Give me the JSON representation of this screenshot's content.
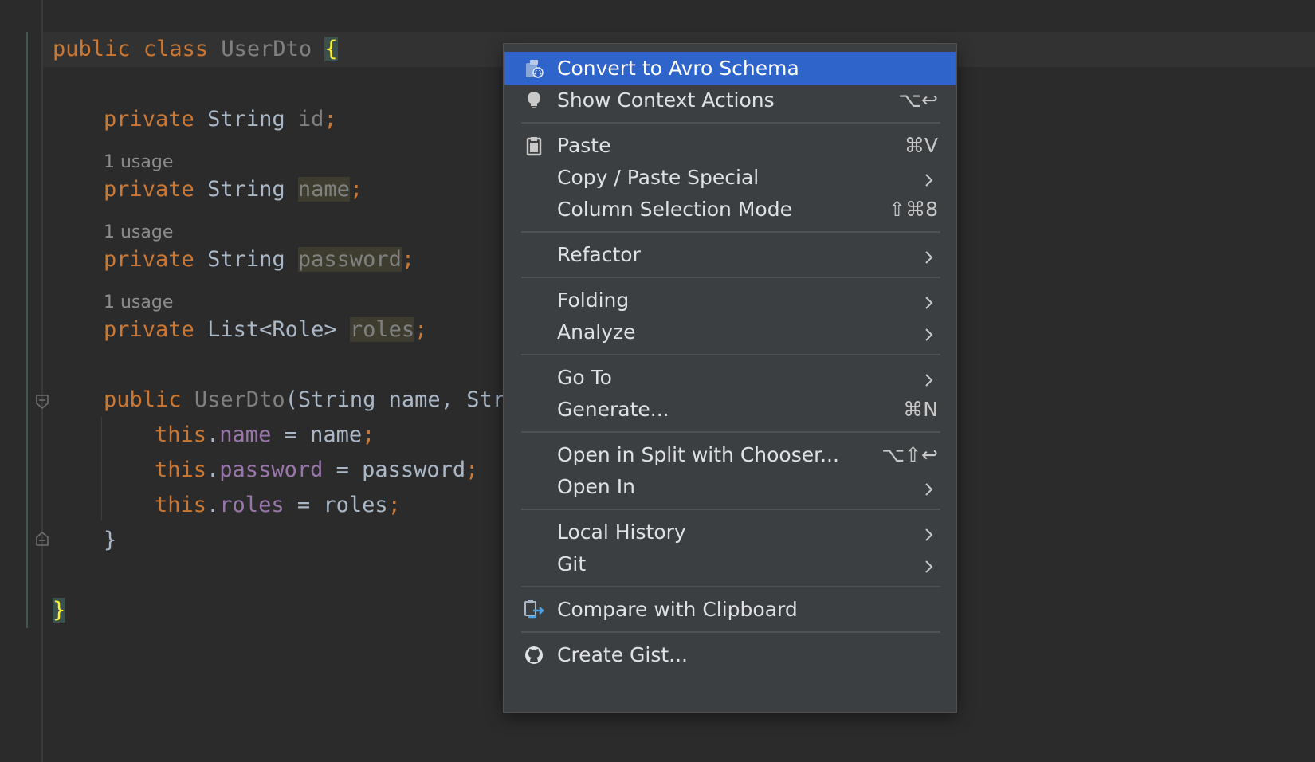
{
  "editor": {
    "lines": {
      "class_decl": {
        "kw1": "public",
        "kw2": "class",
        "name": "UserDto",
        "brace": "{"
      },
      "field_id": {
        "kw": "private",
        "type": "String",
        "name": "id",
        "semi": ";"
      },
      "usage1": "1 usage",
      "field_name": {
        "kw": "private",
        "type": "String",
        "name": "name",
        "semi": ";"
      },
      "usage2": "1 usage",
      "field_password": {
        "kw": "private",
        "type": "String",
        "name": "password",
        "semi": ";"
      },
      "usage3": "1 usage",
      "field_roles": {
        "kw": "private",
        "type": "List<Role>",
        "name": "roles",
        "semi": ";"
      },
      "ctor": {
        "kw": "public",
        "name": "UserDto",
        "params": "(String name, ",
        "params_cut": "Stri"
      },
      "assign1": {
        "this": "this",
        "dot": ".",
        "field": "name",
        "rest": " = name",
        "semi": ";"
      },
      "assign2": {
        "this": "this",
        "dot": ".",
        "field": "password",
        "rest": " = password",
        "semi": ";"
      },
      "assign3": {
        "this": "this",
        "dot": ".",
        "field": "roles",
        "rest": " = roles",
        "semi": ";"
      },
      "ctor_close": "}",
      "class_close": "}"
    }
  },
  "context_menu": {
    "items": [
      {
        "label": "Convert to Avro Schema",
        "icon": "avro-icon",
        "selected": true
      },
      {
        "label": "Show Context Actions",
        "icon": "lightbulb-icon",
        "shortcut": "⌥↩"
      },
      {
        "label": "Paste",
        "icon": "clipboard-icon",
        "shortcut": "⌘V"
      },
      {
        "label": "Copy / Paste Special",
        "submenu": true
      },
      {
        "label": "Column Selection Mode",
        "shortcut": "⇧⌘8"
      },
      {
        "label": "Refactor",
        "submenu": true
      },
      {
        "label": "Folding",
        "submenu": true
      },
      {
        "label": "Analyze",
        "submenu": true
      },
      {
        "label": "Go To",
        "submenu": true
      },
      {
        "label": "Generate...",
        "shortcut": "⌘N"
      },
      {
        "label": "Open in Split with Chooser...",
        "shortcut": "⌥⇧↩"
      },
      {
        "label": "Open In",
        "submenu": true
      },
      {
        "label": "Local History",
        "submenu": true
      },
      {
        "label": "Git",
        "submenu": true
      },
      {
        "label": "Compare with Clipboard",
        "icon": "compare-icon"
      },
      {
        "label": "Create Gist...",
        "icon": "github-icon"
      }
    ]
  },
  "colors": {
    "editor_bg": "#2b2b2b",
    "keyword": "#cc7832",
    "field": "#9876aa",
    "menu_bg": "#3c3f41",
    "selection": "#2f65ca"
  }
}
